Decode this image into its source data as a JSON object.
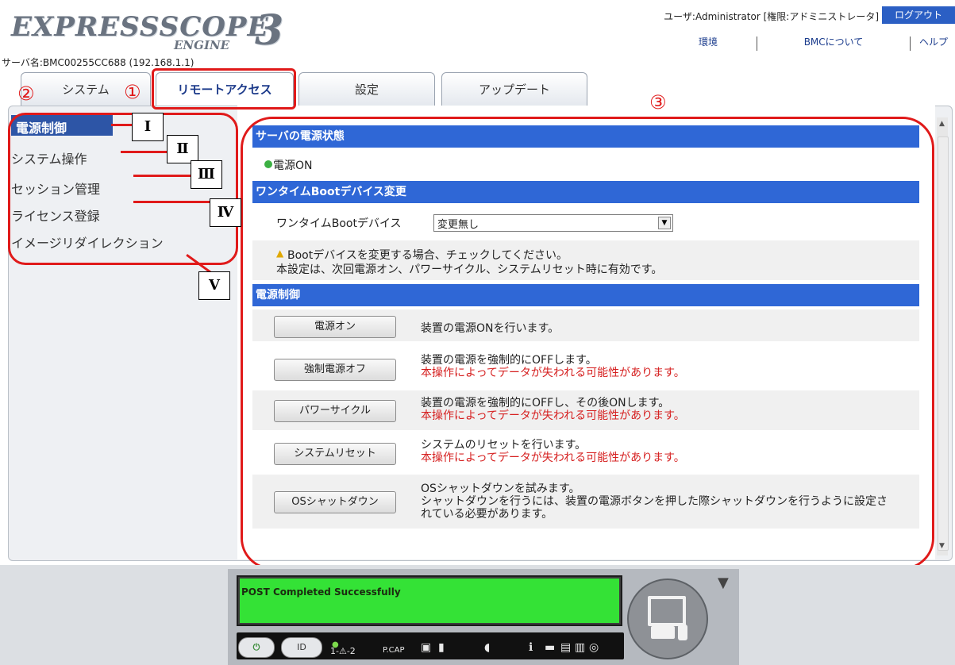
{
  "header": {
    "logo_main": "EXPRESSSCOPE",
    "logo_sub": "ENGINE",
    "logo_num": "3",
    "user_info": "ユーザ:Administrator [権限:アドミニストレータ]",
    "logout": "ログアウト",
    "links": [
      "環境",
      "BMCについて",
      "ヘルプ"
    ],
    "server_name": "サーバ名:BMC00255CC688 (192.168.1.1)"
  },
  "tabs": [
    "システム",
    "リモートアクセス",
    "設定",
    "アップデート"
  ],
  "sidebar": {
    "items": [
      "電源制御",
      "システム操作",
      "セッション管理",
      "ライセンス登録",
      "イメージリダイレクション"
    ]
  },
  "content": {
    "power_state_header": "サーバの電源状態",
    "power_state": "電源ON",
    "boot_header": "ワンタイムBootデバイス変更",
    "boot_label": "ワンタイムBootデバイス",
    "boot_value": "変更無し",
    "boot_note1": "Bootデバイスを変更する場合、チェックしてください。",
    "boot_note2": "本設定は、次回電源オン、パワーサイクル、システムリセット時に有効です。",
    "power_control_header": "電源制御",
    "actions": [
      {
        "button": "電源オン",
        "desc": "装置の電源ONを行います。",
        "warn": ""
      },
      {
        "button": "強制電源オフ",
        "desc": "装置の電源を強制的にOFFします。",
        "warn": "本操作によってデータが失われる可能性があります。"
      },
      {
        "button": "パワーサイクル",
        "desc": "装置の電源を強制的にOFFし、その後ONします。",
        "warn": "本操作によってデータが失われる可能性があります。"
      },
      {
        "button": "システムリセット",
        "desc": "システムのリセットを行います。",
        "warn": "本操作によってデータが失われる可能性があります。"
      },
      {
        "button": "OSシャットダウン",
        "desc": "OSシャットダウンを試みます。",
        "desc2": "シャットダウンを行うには、装置の電源ボタンを押した際シャットダウンを行うように設定さ",
        "desc3": "れている必要があります。"
      }
    ]
  },
  "annotations": {
    "circled": [
      "①",
      "②",
      "③"
    ],
    "roman": [
      "I",
      "Ⅱ",
      "Ⅲ",
      "Ⅳ",
      "V"
    ]
  },
  "console": {
    "lcd_text": "POST Completed Successfully",
    "id_label": "ID",
    "led_labels": "1-⚠-2",
    "pcap": "P.CAP"
  },
  "colors": {
    "section_header": "#2f67d6",
    "annotation": "#e01a1a",
    "lcd": "#34e236"
  }
}
